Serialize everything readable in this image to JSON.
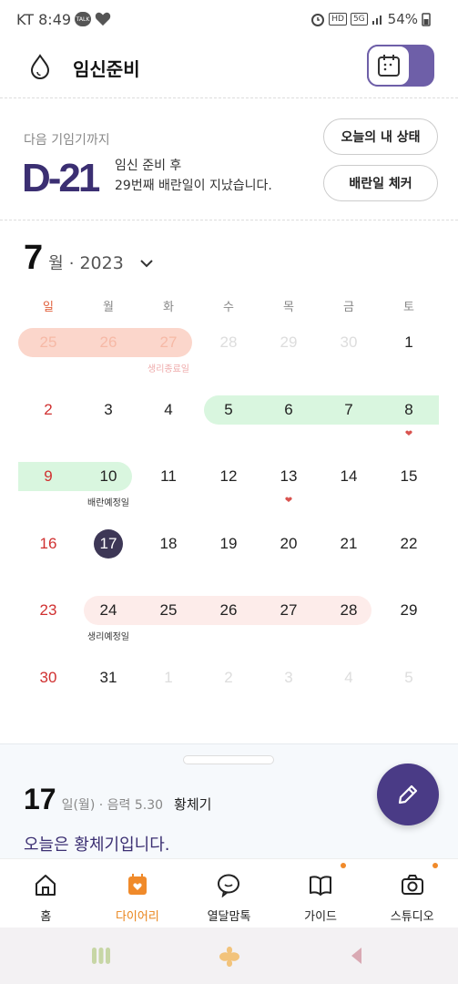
{
  "status_bar": {
    "carrier": "KT",
    "time": "8:49",
    "talk_badge": "TALK",
    "hd": "HD",
    "net": "5G",
    "battery": "54%"
  },
  "header": {
    "title": "임신준비"
  },
  "dday": {
    "subtitle": "다음 기임기까지",
    "countdown": "D-21",
    "desc_line1": "임신 준비 후",
    "desc_line2": "29번째 배란일이 지났습니다.",
    "today_status_button": "오늘의 내 상태",
    "ovulation_check_button": "배란일 체커"
  },
  "calendar": {
    "month": "7",
    "month_suffix": "월",
    "separator": "·",
    "year": "2023",
    "weekdays": [
      "일",
      "월",
      "화",
      "수",
      "목",
      "금",
      "토"
    ],
    "weeks": [
      [
        "25",
        "26",
        "27",
        "28",
        "29",
        "30",
        "1"
      ],
      [
        "2",
        "3",
        "4",
        "5",
        "6",
        "7",
        "8"
      ],
      [
        "9",
        "10",
        "11",
        "12",
        "13",
        "14",
        "15"
      ],
      [
        "16",
        "17",
        "18",
        "19",
        "20",
        "21",
        "22"
      ],
      [
        "23",
        "24",
        "25",
        "26",
        "27",
        "28",
        "29"
      ],
      [
        "30",
        "31",
        "1",
        "2",
        "3",
        "4",
        "5"
      ]
    ],
    "label_period_end": "생리종료일",
    "label_ovulation_end": "배란예정일",
    "label_period_expected": "생리예정일",
    "colors": {
      "period": "#fbd6cb",
      "fertile": "#d9f6df",
      "expected": "#fdecea",
      "today": "#3d3756",
      "sunday": "#d03030"
    }
  },
  "sheet": {
    "day": "17",
    "meta": "일(월) · 음력 5.30",
    "phase": "황체기",
    "message": "오늘은 황체기입니다."
  },
  "nav": {
    "items": [
      {
        "label": "홈",
        "icon": "home-icon"
      },
      {
        "label": "다이어리",
        "icon": "diary-icon"
      },
      {
        "label": "열달맘톡",
        "icon": "chat-icon"
      },
      {
        "label": "가이드",
        "icon": "book-icon"
      },
      {
        "label": "스튜디오",
        "icon": "camera-icon"
      }
    ],
    "active_color": "#e9841a"
  }
}
